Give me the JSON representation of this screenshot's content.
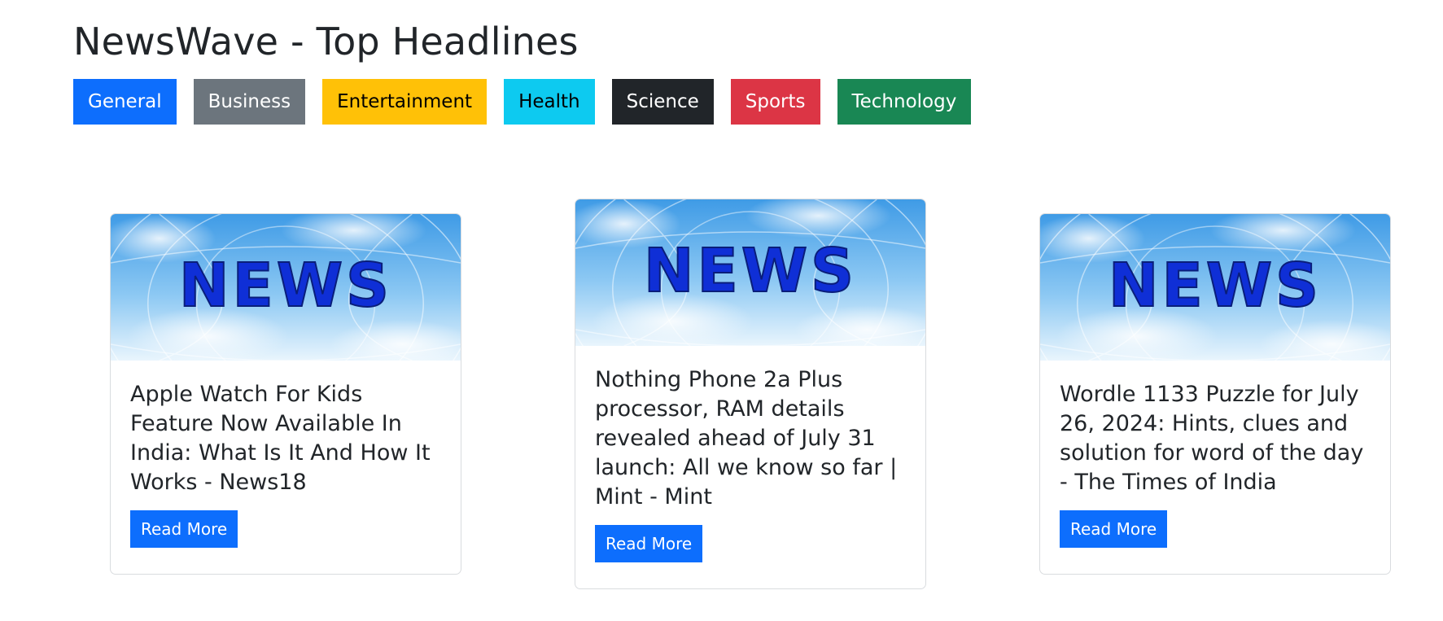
{
  "header": {
    "title": "NewsWave - Top Headlines"
  },
  "categories": [
    {
      "label": "General",
      "bg": "#0d6efd",
      "fg": "#ffffff"
    },
    {
      "label": "Business",
      "bg": "#6c757d",
      "fg": "#ffffff"
    },
    {
      "label": "Entertainment",
      "bg": "#ffc107",
      "fg": "#000000"
    },
    {
      "label": "Health",
      "bg": "#0dcaf0",
      "fg": "#000000"
    },
    {
      "label": "Science",
      "bg": "#212529",
      "fg": "#ffffff"
    },
    {
      "label": "Sports",
      "bg": "#dc3545",
      "fg": "#ffffff"
    },
    {
      "label": "Technology",
      "bg": "#198754",
      "fg": "#ffffff"
    }
  ],
  "articles": [
    {
      "image_text": "NEWS",
      "title": "Apple Watch For Kids Feature Now Available In India: What Is It And How It Works - News18",
      "button_label": "Read More"
    },
    {
      "image_text": "NEWS",
      "title": "Nothing Phone 2a Plus processor, RAM details revealed ahead of July 31 launch: All we know so far | Mint - Mint",
      "button_label": "Read More"
    },
    {
      "image_text": "NEWS",
      "title": "Wordle 1133 Puzzle for July 26, 2024: Hints, clues and solution for word of the day - The Times of India",
      "button_label": "Read More"
    }
  ],
  "colors": {
    "accent": "#0d6efd"
  }
}
